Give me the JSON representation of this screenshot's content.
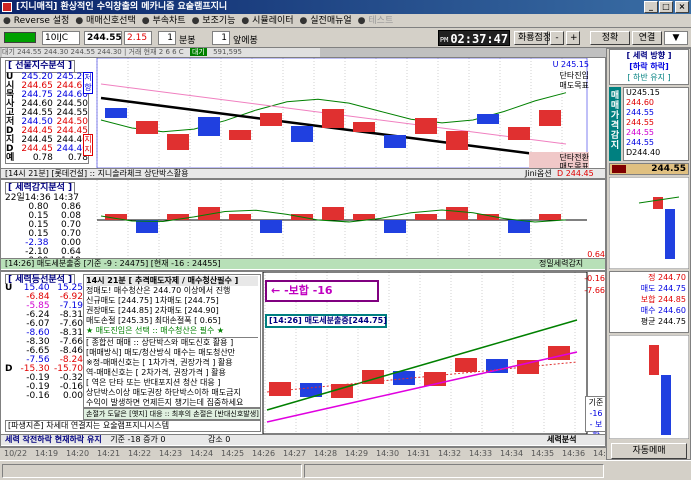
{
  "title": "[지니매직] 환상적인 수익창출의 메카니즘 요술램프지니",
  "menu": [
    {
      "label": "Reverse 설정",
      "enabled": true
    },
    {
      "label": "매매신호선택",
      "enabled": true
    },
    {
      "label": "부속차트",
      "enabled": true
    },
    {
      "label": "보조기능",
      "enabled": true
    },
    {
      "label": "시뮬레이터",
      "enabled": true
    },
    {
      "label": "실전매뉴얼",
      "enabled": true
    },
    {
      "label": "테스트",
      "enabled": false
    }
  ],
  "toolbar": {
    "code": "10IJC",
    "price": "244.55",
    "change": "2.15",
    "period": "1",
    "period_unit": "분봉",
    "ahead": "1",
    "ahead_unit": "앞에봉",
    "clock_ampm": "PM",
    "clock": "02:37:47",
    "clock_suffix": "set",
    "screen_set_label": "화룡점정",
    "minus": "-",
    "plus": "+",
    "auto_label": "정확",
    "link_label": "연결",
    "screen_label": "화면",
    "screen_no": "20"
  },
  "infostrip": {
    "left": "대기 244.55 244.30 244.55 244.30 | 거래 현재 2 6 6 C",
    "tag": "대기",
    "value": "591,595"
  },
  "panel1": {
    "title": "[ 선물지수분석 ]",
    "rows": [
      {
        "lbl": "U",
        "v1": "245.20",
        "v2": "245.20",
        "c1": "blue",
        "c2": "blue"
      },
      {
        "lbl": "시",
        "v1": "244.65",
        "v2": "244.65",
        "c1": "red",
        "c2": "red"
      },
      {
        "lbl": "목",
        "v1": "244.75",
        "v2": "244.60",
        "c1": "blue",
        "c2": "blue"
      },
      {
        "lbl": "사",
        "v1": "244.60",
        "v2": "244.50",
        "c1": "",
        "c2": ""
      },
      {
        "lbl": "고",
        "v1": "244.55",
        "v2": "244.55",
        "c1": "",
        "c2": ""
      },
      {
        "lbl": "저",
        "v1": "244.50",
        "v2": "244.50",
        "c1": "blue",
        "c2": "red"
      },
      {
        "lbl": "D",
        "v1": "244.45",
        "v2": "244.45",
        "c1": "red",
        "c2": "red"
      },
      {
        "lbl": "지",
        "v1": "244.45",
        "v2": "244.40",
        "c1": "",
        "c2": ""
      },
      {
        "lbl": "D",
        "v1": "244.45",
        "v2": "244.40",
        "c1": "red",
        "c2": "blue"
      },
      {
        "lbl": "예",
        "v1": "0.78",
        "v2": "0.78",
        "c1": "",
        "c2": ""
      }
    ],
    "side_marker_top": "저항",
    "side_marker_bottom": "지지",
    "status": "[14시 21분] [롯데건설] :: 지니솔라체크 상단박스활용",
    "status_right": "Jini옵션",
    "right_label1": "U 245.15",
    "right_label2": "단타진입",
    "right_label3": "매도목표",
    "right_label4": "단타전환",
    "right_label5": "매도목표",
    "right_label6": "D 244.45"
  },
  "panel2": {
    "title": "[ 세력감지분석 ]",
    "time_label": "22일14:36",
    "time_value": "14:37",
    "rows": [
      {
        "lbl": "",
        "v1": "0.80",
        "v2": "0.86",
        "c1": "",
        "c2": ""
      },
      {
        "lbl": "",
        "v1": "0.15",
        "v2": "0.08",
        "c1": "",
        "c2": ""
      },
      {
        "lbl": "",
        "v1": "0.15",
        "v2": "0.70",
        "c1": "",
        "c2": ""
      },
      {
        "lbl": "",
        "v1": "0.15",
        "v2": "0.70",
        "c1": "",
        "c2": ""
      },
      {
        "lbl": "",
        "v1": "-2.38",
        "v2": "0.00",
        "c1": "blue",
        "c2": ""
      },
      {
        "lbl": "",
        "v1": "-2.10",
        "v2": "0.64",
        "c1": "",
        "c2": ""
      },
      {
        "lbl": "",
        "v1": "0.00",
        "v2": "-1.19",
        "c1": "",
        "c2": ""
      }
    ],
    "status": "[14:26] 매도세분출중 [기준 -9 : 24475] [현재 -16 : 24455]",
    "status_right": "정밀세력감지",
    "right_value": "0.64"
  },
  "panel3": {
    "title": "[ 세력등선분석 ]",
    "rows": [
      {
        "lbl": "U",
        "v1": "15.40",
        "v2": "15.25",
        "c1": "blue",
        "c2": "blue"
      },
      {
        "lbl": "",
        "v1": "-6.84",
        "v2": "-6.92",
        "c1": "red",
        "c2": "red"
      },
      {
        "lbl": "",
        "v1": "-5.85",
        "v2": "-7.19",
        "c1": "magenta",
        "c2": "blue"
      },
      {
        "lbl": "",
        "v1": "-6.24",
        "v2": "-8.31",
        "c1": "",
        "c2": ""
      },
      {
        "lbl": "",
        "v1": "-6.07",
        "v2": "-7.60",
        "c1": "",
        "c2": ""
      },
      {
        "lbl": "",
        "v1": "-8.60",
        "v2": "-8.31",
        "c1": "blue",
        "c2": ""
      },
      {
        "lbl": "",
        "v1": "-8.30",
        "v2": "-7.66",
        "c1": "",
        "c2": ""
      },
      {
        "lbl": "",
        "v1": "-6.65",
        "v2": "-8.46",
        "c1": "",
        "c2": ""
      },
      {
        "lbl": "",
        "v1": "-7.56",
        "v2": "-8.24",
        "c1": "blue",
        "c2": "red"
      },
      {
        "lbl": "D",
        "v1": "-15.30",
        "v2": "-15.70",
        "c1": "red",
        "c2": "red"
      },
      {
        "lbl": "",
        "v1": "-0.19",
        "v2": "-0.32",
        "c1": "",
        "c2": ""
      },
      {
        "lbl": "",
        "v1": "-0.19",
        "v2": "-0.16",
        "c1": "",
        "c2": ""
      },
      {
        "lbl": "",
        "v1": "-0.16",
        "v2": "0.00",
        "c1": "",
        "c2": ""
      }
    ],
    "info_header": "14시 21분 [ 추격매도자제 / 매수청산필수 ]",
    "info_lines": [
      "정매도! 매수청산은 244.70 이상에서 진행",
      "신규매도 [244.75]       1차매도 [244.75]",
      "권장매도 [244.85]       2차매도 [244.90]",
      "매도손절 [245.35]       최대손절폭 [ 0.65]",
      "★ 매도진입은 선택   ::   매수청산은 필수 ★"
    ],
    "rule_lines": [
      "[ 종합선 매매 :: 상단박스와 매도신호 활용 ]",
      "[매매방식] 매도/청산방식 매수는 매도청산만",
      "※정-매매신호는 [ 1차가격, 권장가격 ] 활용",
      "  역-매매신호는 [ 2차가격, 권장가격 ] 활용",
      "  [ 역은 단타 또는 반대포지션 청산 대응 ]",
      "상단박스이상 매도권장  하단박스이하 매도금지",
      "수익이 발생하면 언제든지 챙기는데 집중하세요"
    ],
    "note1": "손절가 도달은 [옛지] 대응 :: 최후의 손절은 [반대신호발생]",
    "note2": "[파생지존] 차세대 연결지는 요술램프지니시스템",
    "alert": "-보합 -16",
    "alert_box": "[14:26] 매도세분출중[244.75]",
    "status_left": "세력 작전하락 현재하락 유지",
    "status_mid": "기준 -18 증가 0",
    "status_mid2": "감소 0",
    "status_right": "세력분석",
    "right_value1": "-0.16",
    "right_value2": "-7.66",
    "right_box_label": "기준",
    "right_box_v1": "-16",
    "right_box_v2": "- 보합"
  },
  "right_panel": {
    "title": "[ 세력 방향 ]",
    "subtitle": "[하락 하락]",
    "subtitle2": "[ 하반 유지 ]",
    "vtabs": [
      "매",
      "매",
      "가",
      "격",
      "감",
      "지"
    ],
    "vtab_text": "매매가격감지",
    "prices": [
      {
        "label": "U245.15",
        "color": ""
      },
      {
        "label": "244.60",
        "color": "red"
      },
      {
        "label": "244.55",
        "color": "blue"
      },
      {
        "label": "244.55",
        "color": "red"
      },
      {
        "label": "244.55",
        "color": "magenta"
      },
      {
        "label": "244.55",
        "color": "blue"
      },
      {
        "label": "D244.40",
        "color": ""
      }
    ],
    "bottom_label": "244.55",
    "mid_labels": [
      {
        "label": "정 244.70",
        "color": "red"
      },
      {
        "label": "매도 244.75",
        "color": "blue"
      },
      {
        "label": "보합 244.85",
        "color": "red"
      },
      {
        "label": "매수 244.60",
        "color": "blue"
      },
      {
        "label": "평균 244.75",
        "color": ""
      }
    ],
    "auto_button": "자동메매"
  },
  "bottom_axis": [
    "10/22",
    "14:19",
    "14:20",
    "14:21",
    "14:22",
    "14:23",
    "14:24",
    "14:25",
    "14:26",
    "14:27",
    "14:28",
    "14:29",
    "14:30",
    "14:31",
    "14:32",
    "14:33",
    "14:34",
    "14:35",
    "14:36",
    "14:37"
  ]
}
